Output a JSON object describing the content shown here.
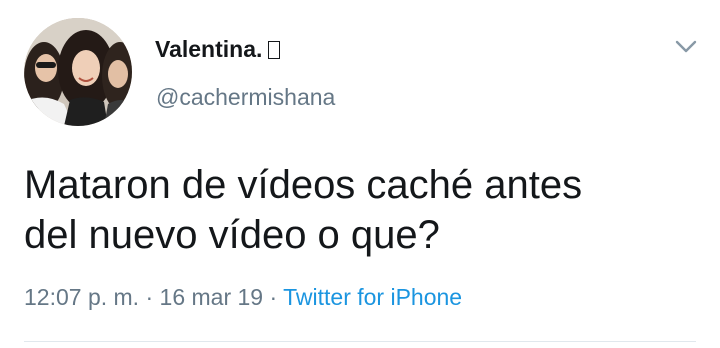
{
  "tweet": {
    "author": {
      "display_name": "Valentina.",
      "emoji_icon": "missing-glyph-box",
      "handle": "@cachermishana"
    },
    "text_line1": "Mataron de vídeos caché antes",
    "text_line2": "del nuevo vídeo o que?",
    "time": "12:07 p. m.",
    "separator1": " · ",
    "date": "16 mar 19",
    "separator2": " · ",
    "source": "Twitter for iPhone"
  },
  "colors": {
    "text_primary": "#14171a",
    "text_secondary": "#657786",
    "link": "#1b95e0",
    "divider": "#e1e8ed"
  }
}
